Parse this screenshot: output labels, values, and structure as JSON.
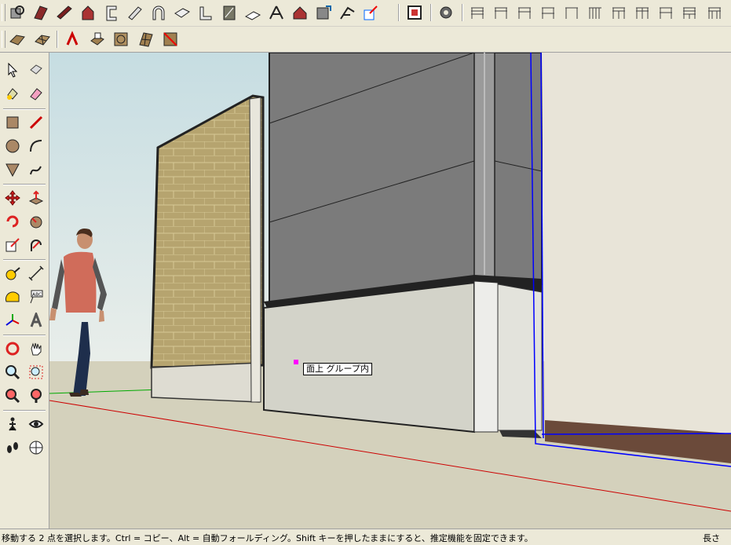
{
  "toolbar_top": {
    "icons": [
      "select-tool-icon",
      "wall-icon",
      "beam-icon",
      "house-icon",
      "column-icon",
      "pipe-icon",
      "arch-icon",
      "slab-icon",
      "stair-icon",
      "window-icon",
      "roof-icon",
      "truss-icon",
      "building-icon",
      "duct-icon",
      "rafter-icon",
      "tag-icon",
      "image-icon",
      "component-icon",
      "railing-1-icon",
      "railing-2-icon",
      "railing-3-icon",
      "railing-4-icon",
      "railing-5-icon",
      "railing-6-icon",
      "railing-7-icon",
      "railing-8-icon",
      "railing-9-icon",
      "railing-10-icon",
      "railing-11-icon"
    ]
  },
  "toolbar_second": {
    "icons": [
      "sandbox-from-contours-icon",
      "sandbox-from-scratch-icon",
      "smoove-icon",
      "stamp-icon",
      "drape-icon",
      "add-detail-icon",
      "flip-edge-icon"
    ]
  },
  "left_toolbar": {
    "icons": [
      "select-icon",
      "make-component-icon",
      "paint-bucket-icon",
      "eraser-icon",
      "rectangle-icon",
      "line-icon",
      "circle-icon",
      "arc-icon",
      "polygon-icon",
      "freehand-icon",
      "move-icon",
      "push-pull-icon",
      "rotate-icon",
      "follow-me-icon",
      "scale-icon",
      "offset-icon",
      "tape-measure-icon",
      "dimension-icon",
      "protractor-icon",
      "text-icon",
      "axes-icon",
      "3d-text-icon",
      "orbit-icon",
      "pan-icon",
      "zoom-icon",
      "zoom-window-icon",
      "zoom-extents-icon",
      "previous-view-icon",
      "position-camera-icon",
      "look-around-icon",
      "walk-icon",
      "section-plane-icon"
    ]
  },
  "viewport": {
    "tooltip": "面上 グループ内"
  },
  "status": {
    "message": "移動する 2 点を選択します。Ctrl = コピー、Alt = 自動フォールディング。Shift キーを押したままにすると、推定機能を固定できます。",
    "measurement_label": "長さ"
  },
  "colors": {
    "sky_top": "#c9dfe3",
    "ground": "#d3d0bb",
    "wall_dark": "#7a7a7a",
    "stone": "#b7a46e",
    "selection_blue": "#0000ff",
    "axis_red": "#cc0000",
    "axis_green": "#00aa00"
  }
}
